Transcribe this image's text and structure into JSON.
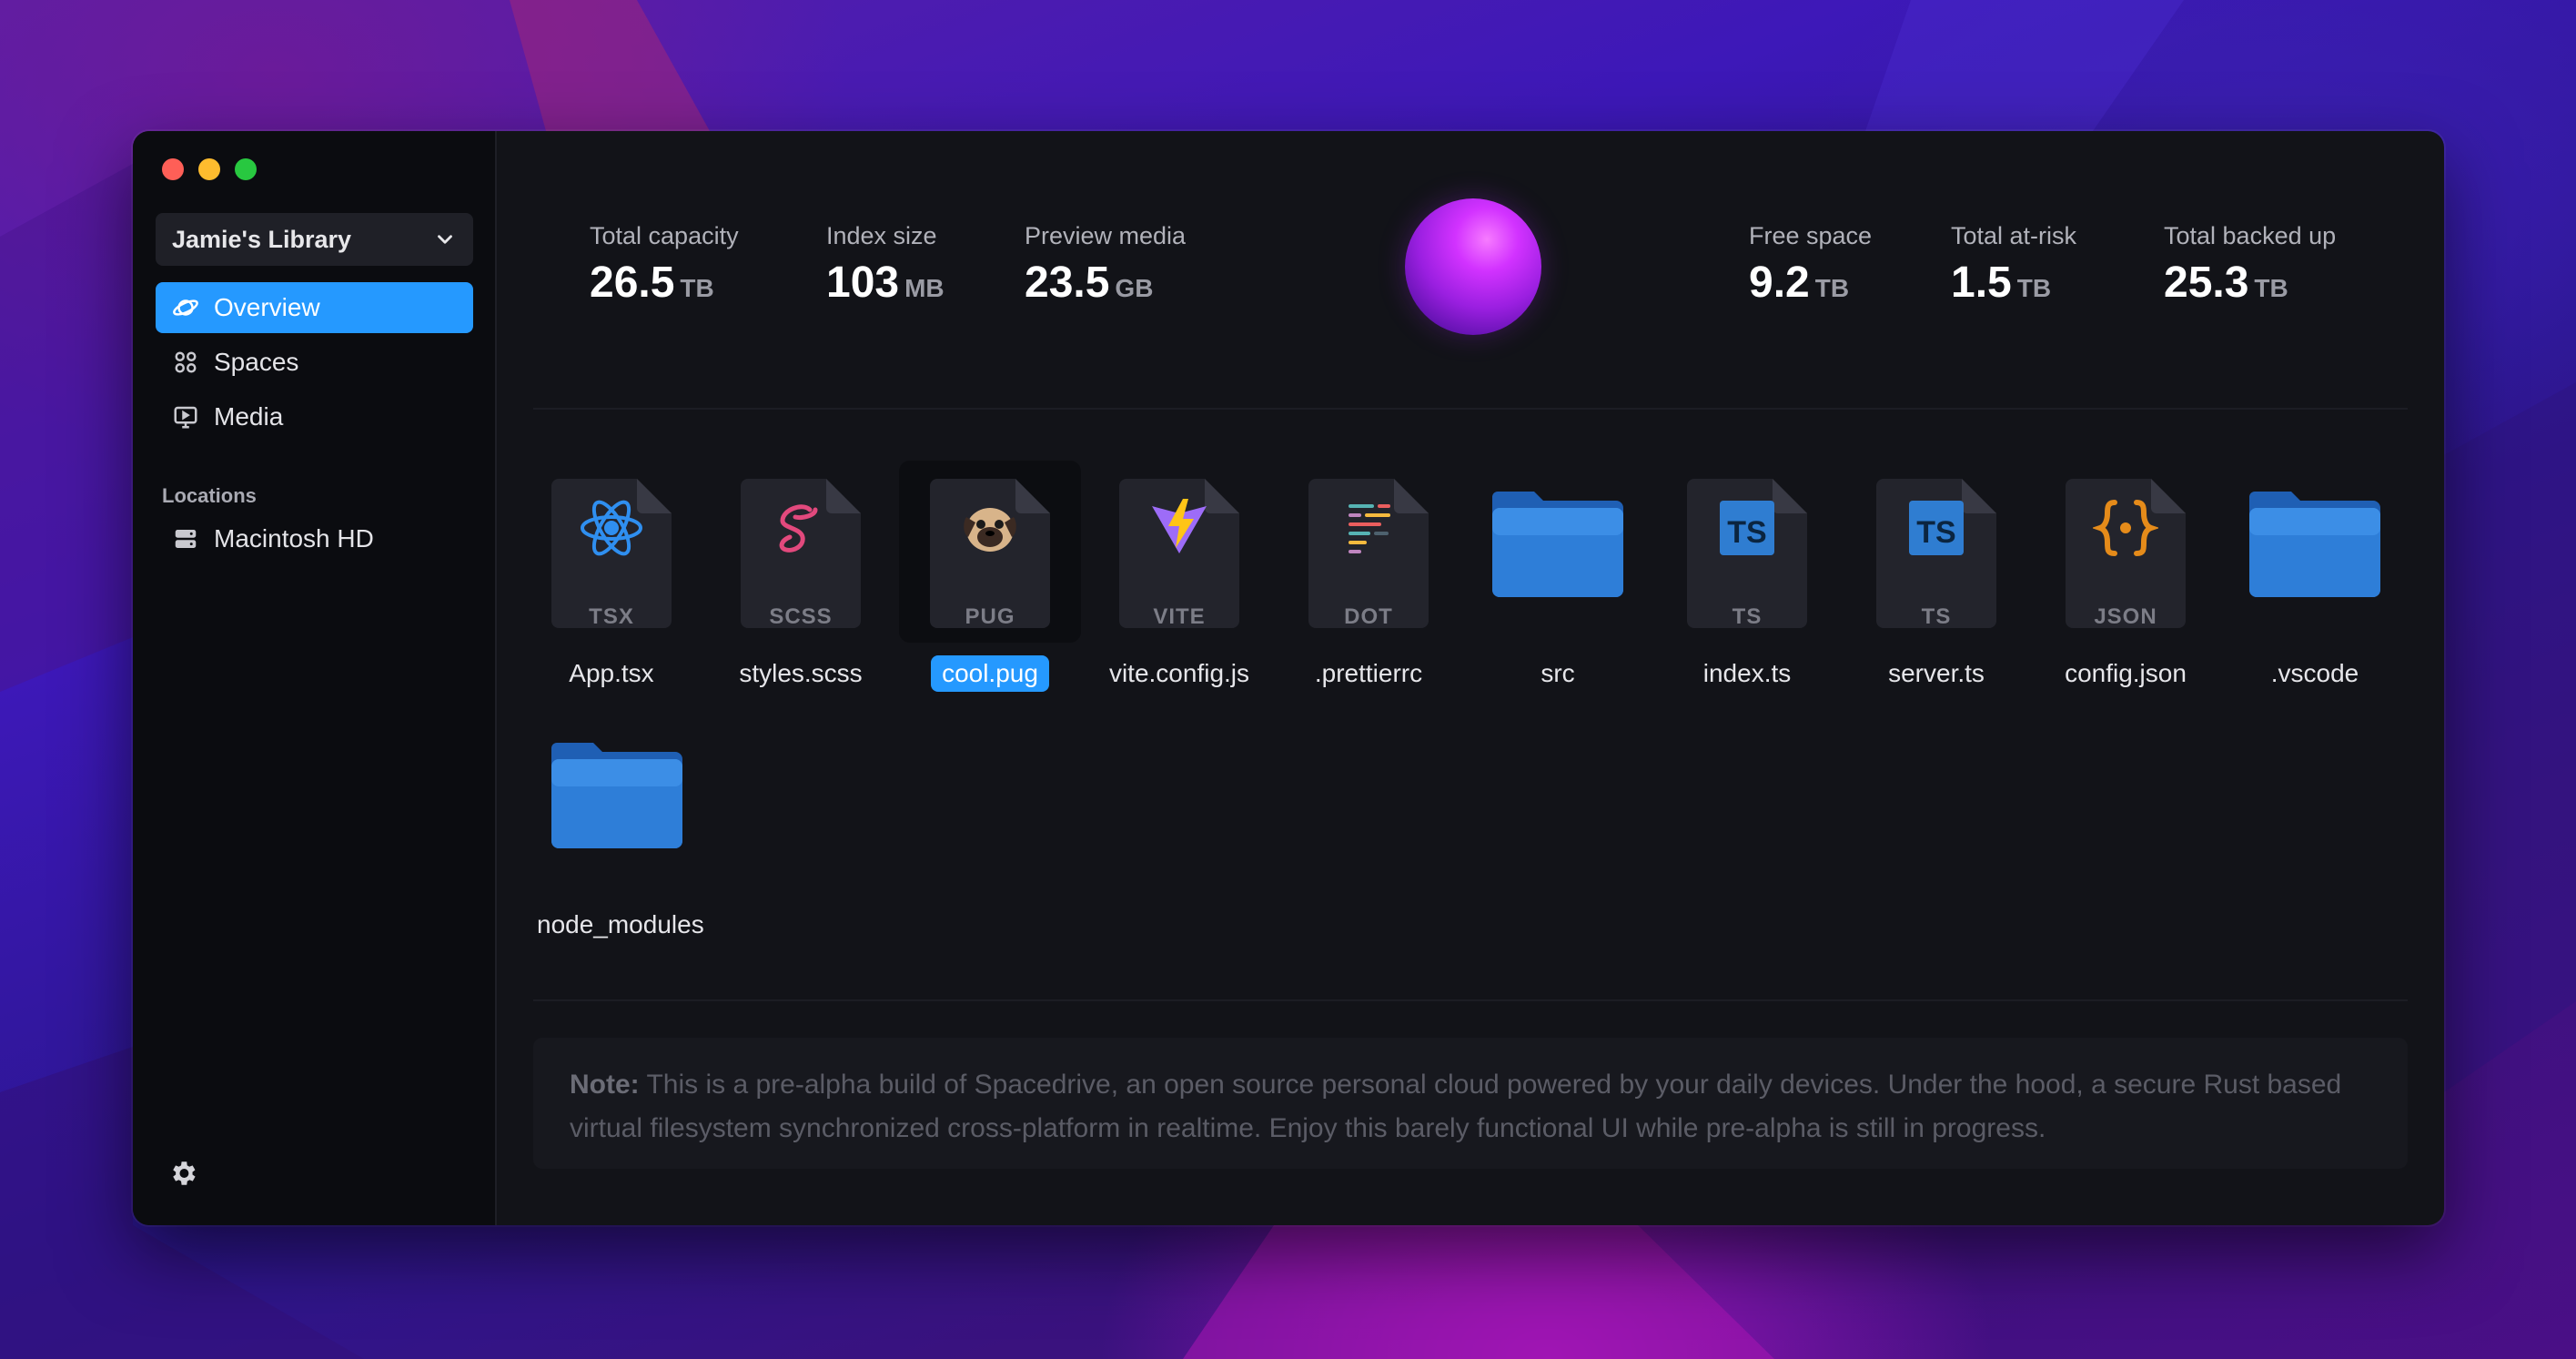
{
  "window": {
    "library_name": "Jamie's Library"
  },
  "sidebar": {
    "items": [
      {
        "label": "Overview",
        "icon": "planet-icon",
        "active": true
      },
      {
        "label": "Spaces",
        "icon": "grid-icon",
        "active": false
      },
      {
        "label": "Media",
        "icon": "monitor-play-icon",
        "active": false
      }
    ],
    "locations_label": "Locations",
    "locations": [
      {
        "label": "Macintosh HD",
        "icon": "drive-icon"
      }
    ]
  },
  "stats": {
    "total_capacity": {
      "label": "Total capacity",
      "value": "26.5",
      "unit": "TB"
    },
    "index_size": {
      "label": "Index size",
      "value": "103",
      "unit": "MB"
    },
    "preview_media": {
      "label": "Preview media",
      "value": "23.5",
      "unit": "GB"
    },
    "free_space": {
      "label": "Free space",
      "value": "9.2",
      "unit": "TB"
    },
    "total_at_risk": {
      "label": "Total at-risk",
      "value": "1.5",
      "unit": "TB"
    },
    "total_backed_up": {
      "label": "Total backed up",
      "value": "25.3",
      "unit": "TB"
    }
  },
  "files": [
    {
      "name": "App.tsx",
      "kind": "TSX",
      "icon": "react-icon"
    },
    {
      "name": "styles.scss",
      "kind": "SCSS",
      "icon": "sass-icon"
    },
    {
      "name": "cool.pug",
      "kind": "PUG",
      "icon": "pug-icon",
      "selected": true
    },
    {
      "name": "vite.config.js",
      "kind": "VITE",
      "icon": "vite-icon"
    },
    {
      "name": ".prettierrc",
      "kind": "DOT",
      "icon": "prettier-icon"
    },
    {
      "name": "src",
      "kind": "folder",
      "icon": "folder-icon"
    },
    {
      "name": "index.ts",
      "kind": "TS",
      "icon": "typescript-icon"
    },
    {
      "name": "server.ts",
      "kind": "TS",
      "icon": "typescript-icon"
    },
    {
      "name": "config.json",
      "kind": "JSON",
      "icon": "json-icon"
    },
    {
      "name": ".vscode",
      "kind": "folder",
      "icon": "folder-icon"
    },
    {
      "name": "node_modules",
      "kind": "folder",
      "icon": "folder-icon"
    }
  ],
  "note": {
    "prefix": "Note:",
    "text": "This is a pre-alpha build of Spacedrive, an open source personal cloud powered by your daily devices. Under the hood, a secure Rust based virtual filesystem synchronized cross-platform in realtime. Enjoy this barely functional UI while pre-alpha is still in progress."
  },
  "colors": {
    "accent": "#2599ff",
    "window_bg": "#121318",
    "sidebar_bg": "#0b0c10",
    "folder_blue": "#2e7ed8"
  }
}
